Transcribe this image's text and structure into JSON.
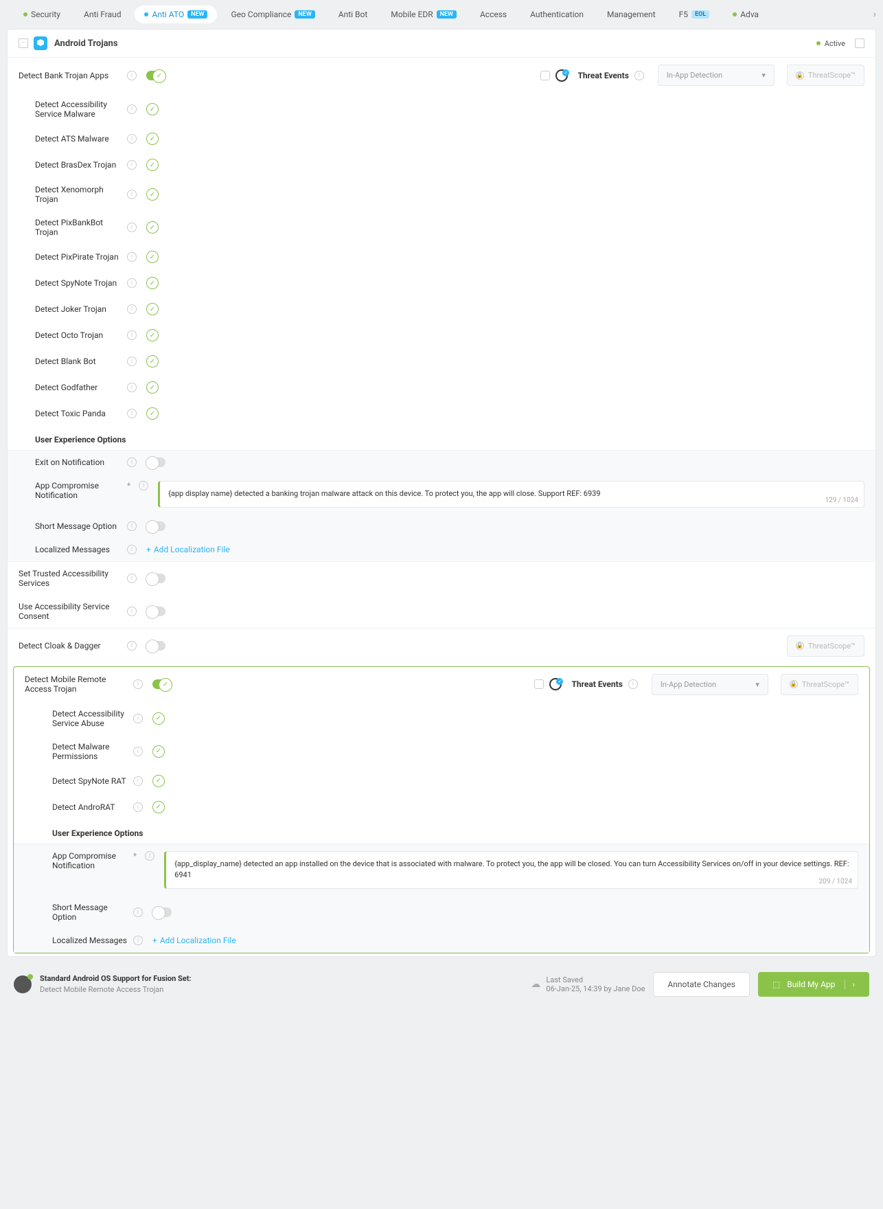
{
  "tabs": [
    {
      "label": "Security",
      "dot": "g"
    },
    {
      "label": "Anti Fraud"
    },
    {
      "label": "Anti ATO",
      "dot": "c",
      "badge": "NEW",
      "active": true
    },
    {
      "label": "Geo Compliance",
      "badge": "NEW"
    },
    {
      "label": "Anti Bot"
    },
    {
      "label": "Mobile EDR",
      "badge": "NEW"
    },
    {
      "label": "Access"
    },
    {
      "label": "Authentication"
    },
    {
      "label": "Management"
    },
    {
      "label": "F5",
      "eol": "EOL"
    },
    {
      "label": "Adva",
      "dot": "g"
    }
  ],
  "panel": {
    "title": "Android Trojans",
    "status": "Active"
  },
  "threat_events": "Threat Events",
  "detection_select": "In-App Detection",
  "threatscope": "ThreatScope™",
  "bank_trojan": {
    "label": "Detect Bank Trojan Apps",
    "items": [
      "Detect Accessibility Service Malware",
      "Detect ATS Malware",
      "Detect BrasDex Trojan",
      "Detect Xenomorph Trojan",
      "Detect PixBankBot Trojan",
      "Detect PixPirate Trojan",
      "Detect SpyNote Trojan",
      "Detect Joker Trojan",
      "Detect Octo Trojan",
      "Detect Blank Bot",
      "Detect Godfather",
      "Detect Toxic Panda"
    ]
  },
  "ux_title": "User Experience Options",
  "ux1": {
    "exit": "Exit on Notification",
    "compromise": "App Compromise Notification",
    "compromise_text": "{app display name} detected a banking trojan malware attack on this device. To protect you, the app will close. Support REF: 6939",
    "compromise_count": "129 / 1024",
    "short_msg": "Short Message Option",
    "localized": "Localized Messages",
    "add_loc": "Add Localization File"
  },
  "trusted": "Set Trusted Accessibility Services",
  "consent": "Use Accessibility Service Consent",
  "cloak": "Detect Cloak & Dagger",
  "mrat": {
    "label": "Detect Mobile Remote Access Trojan",
    "items": [
      "Detect Accessibility Service Abuse",
      "Detect Malware Permissions",
      "Detect SpyNote RAT",
      "Detect AndroRAT"
    ]
  },
  "ux2": {
    "compromise": "App Compromise Notification",
    "compromise_text": "{app_display_name} detected an app installed on the device that is associated with malware. To protect you, the app will be closed. You can turn Accessibility Services on/off in your device settings. REF: 6941",
    "compromise_count": "209 / 1024",
    "short_msg": "Short Message Option",
    "localized": "Localized Messages",
    "add_loc": "Add Localization File"
  },
  "footer": {
    "title": "Standard Android OS Support for Fusion Set:",
    "sub": "Detect Mobile Remote Access Trojan",
    "last_saved_label": "Last Saved",
    "last_saved": "06-Jan-25, 14:39 by Jane Doe",
    "annotate": "Annotate Changes",
    "build": "Build My App"
  }
}
